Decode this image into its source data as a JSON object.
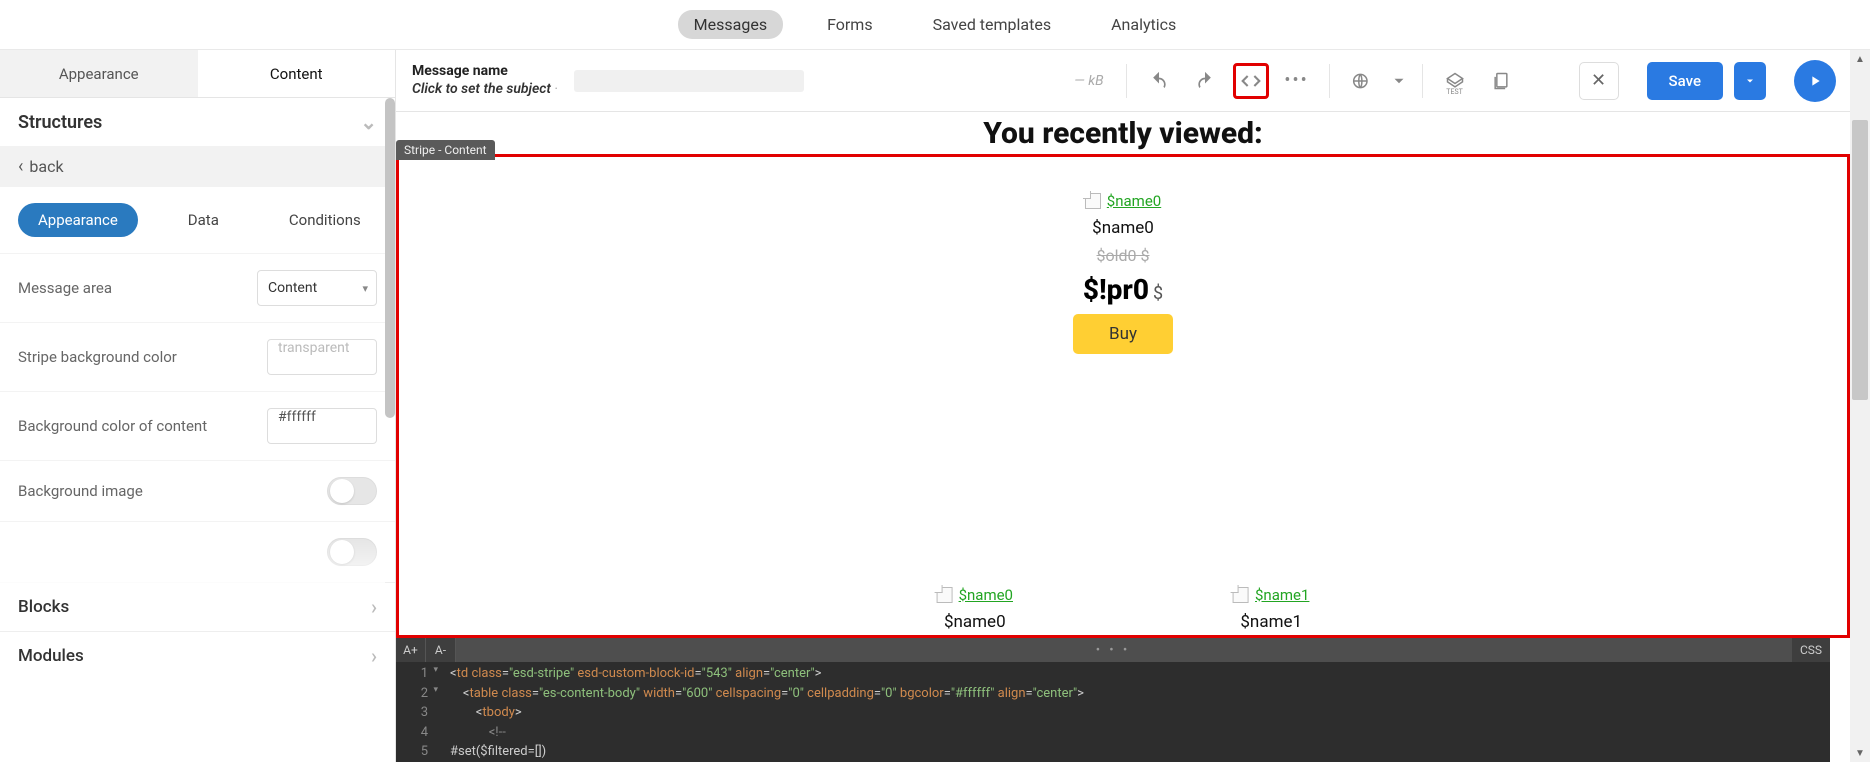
{
  "topnav": {
    "tabs": [
      "Messages",
      "Forms",
      "Saved templates",
      "Analytics"
    ],
    "active": 0
  },
  "left_panel": {
    "tabs": {
      "appearance": "Appearance",
      "content": "Content"
    },
    "section_structures": "Structures",
    "back": "back",
    "subtabs": {
      "appearance": "Appearance",
      "data": "Data",
      "conditions": "Conditions"
    },
    "fields": {
      "message_area": {
        "label": "Message area",
        "value": "Content"
      },
      "stripe_bg": {
        "label": "Stripe background color",
        "value": "transparent"
      },
      "content_bg": {
        "label": "Background color of content",
        "value": "#ffffff"
      },
      "bg_image": {
        "label": "Background image"
      }
    },
    "section_blocks": "Blocks",
    "section_modules": "Modules"
  },
  "toolbar": {
    "message_name": "Message name",
    "subject_placeholder": "Click to set the subject",
    "size": "— kB",
    "save": "Save"
  },
  "canvas": {
    "stripe_tag": "Stripe - Content",
    "heading": "You recently viewed:",
    "feature": {
      "img_alt": "$name0",
      "name": "$name0",
      "old_price": "$old0 $",
      "price": "$!pr0",
      "currency": "$",
      "buy": "Buy"
    },
    "row": [
      {
        "img_alt": "$name0",
        "name": "$name0"
      },
      {
        "img_alt": "$name1",
        "name": "$name1"
      }
    ]
  },
  "code": {
    "btn_inc": "A+",
    "btn_dec": "A-",
    "css_btn": "CSS",
    "lines": [
      "<td class=\"esd-stripe\" esd-custom-block-id=\"543\" align=\"center\">",
      "    <table class=\"es-content-body\" width=\"600\" cellspacing=\"0\" cellpadding=\"0\" bgcolor=\"#ffffff\" align=\"center\">",
      "        <tbody>",
      "            <!--",
      "#set($filtered=[])"
    ]
  },
  "chart_data": null
}
